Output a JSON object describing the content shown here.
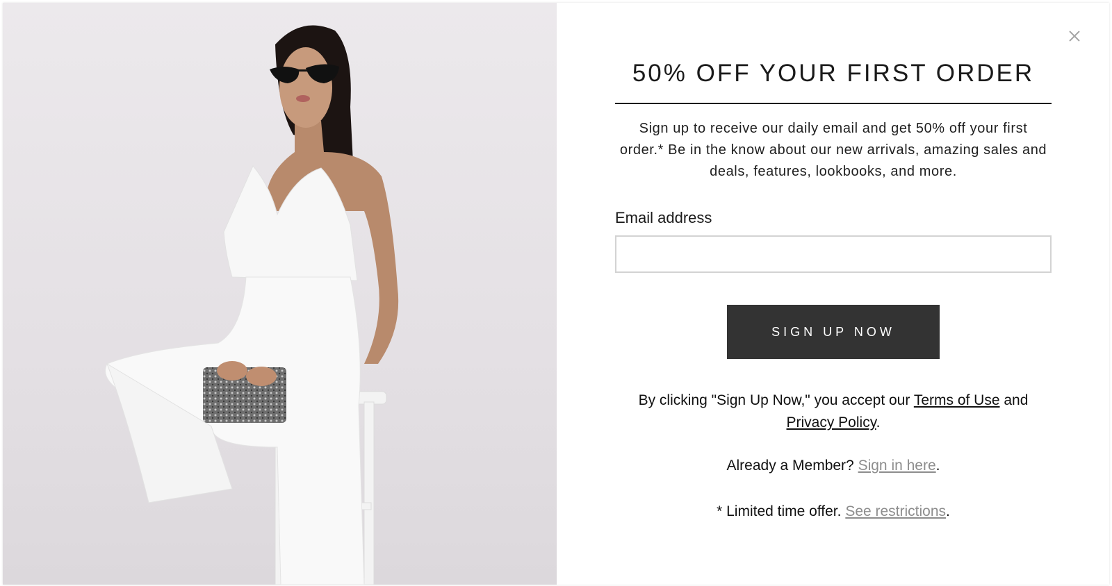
{
  "popup": {
    "headline": "50% OFF YOUR FIRST ORDER",
    "description": "Sign up to receive our daily email and get 50% off your first order.* Be in the know about our new arrivals, amazing sales and deals, features, lookbooks, and more.",
    "close_icon": "close-icon",
    "email": {
      "label": "Email address",
      "value": "",
      "placeholder": ""
    },
    "signup_button": "SIGN UP NOW",
    "terms": {
      "prefix": "By clicking \"Sign Up Now,\" you accept our ",
      "terms_link": "Terms of Use",
      "and": " and ",
      "privacy_link": "Privacy Policy",
      "suffix": "."
    },
    "member": {
      "prefix": "Already a Member? ",
      "link": "Sign in here",
      "suffix": "."
    },
    "limited": {
      "prefix": "* Limited time offer. ",
      "link": "See restrictions",
      "suffix": "."
    }
  },
  "colors": {
    "button": "#333333",
    "muted_link": "#8d8d8d",
    "photo_bg": "#e6e2e6"
  }
}
